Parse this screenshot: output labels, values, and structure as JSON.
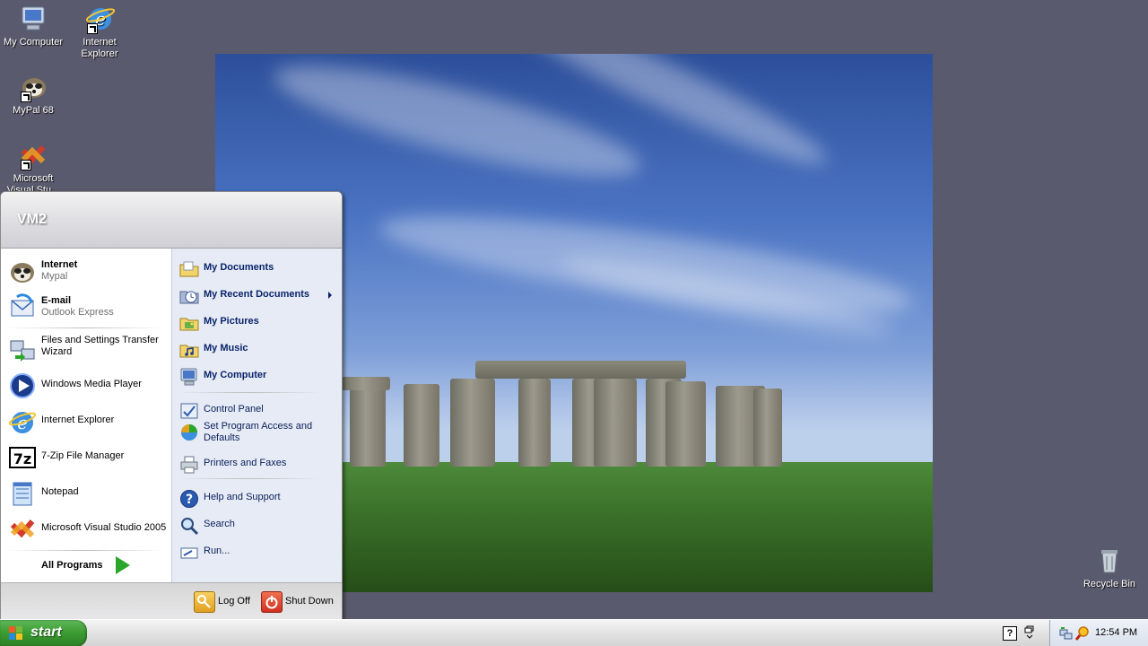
{
  "desktop": {
    "icons": [
      {
        "label": "My Computer",
        "icon": "my-computer-icon"
      },
      {
        "label": "Internet\nExplorer",
        "icon": "internet-explorer-icon"
      },
      {
        "label": "MyPal 68",
        "icon": "mypal-icon"
      },
      {
        "label": "Microsoft\nVisual Stu...",
        "icon": "visual-studio-icon"
      },
      {
        "label": "Recycle Bin",
        "icon": "recycle-bin-icon"
      }
    ]
  },
  "start_menu": {
    "user": "VM2",
    "pinned": [
      {
        "title": "Internet",
        "subtitle": "Mypal",
        "icon": "mypal-icon"
      },
      {
        "title": "E-mail",
        "subtitle": "Outlook Express",
        "icon": "outlook-express-icon"
      }
    ],
    "recent": [
      {
        "label": "Files and Settings Transfer Wizard",
        "icon": "transfer-wizard-icon"
      },
      {
        "label": "Windows Media Player",
        "icon": "media-player-icon"
      },
      {
        "label": "Internet Explorer",
        "icon": "internet-explorer-icon"
      },
      {
        "label": "7-Zip File Manager",
        "icon": "7zip-icon"
      },
      {
        "label": "Notepad",
        "icon": "notepad-icon"
      },
      {
        "label": "Microsoft Visual Studio 2005",
        "icon": "visual-studio-icon"
      }
    ],
    "all_programs": "All Programs",
    "places": [
      {
        "label": "My Documents",
        "icon": "folder-documents-icon"
      },
      {
        "label": "My Recent Documents",
        "icon": "recent-documents-icon"
      },
      {
        "label": "My Pictures",
        "icon": "folder-pictures-icon"
      },
      {
        "label": "My Music",
        "icon": "folder-music-icon"
      },
      {
        "label": "My Computer",
        "icon": "my-computer-icon"
      }
    ],
    "system": [
      {
        "label": "Control Panel",
        "icon": "control-panel-icon"
      },
      {
        "label": "Set Program Access and Defaults",
        "icon": "program-defaults-icon"
      },
      {
        "label": "Printers and Faxes",
        "icon": "printer-icon"
      }
    ],
    "help": [
      {
        "label": "Help and Support",
        "icon": "help-icon"
      },
      {
        "label": "Search",
        "icon": "search-icon"
      },
      {
        "label": "Run...",
        "icon": "run-icon"
      }
    ],
    "log_off": "Log Off",
    "shut_down": "Shut Down"
  },
  "taskbar": {
    "start_label": "start",
    "clock": "12:54 PM"
  },
  "colors": {
    "desktop_bg": "#5a5a6e",
    "start_button": "#3a9a30",
    "places_bg": "#e6ebf5",
    "places_text": "#0a246a"
  }
}
